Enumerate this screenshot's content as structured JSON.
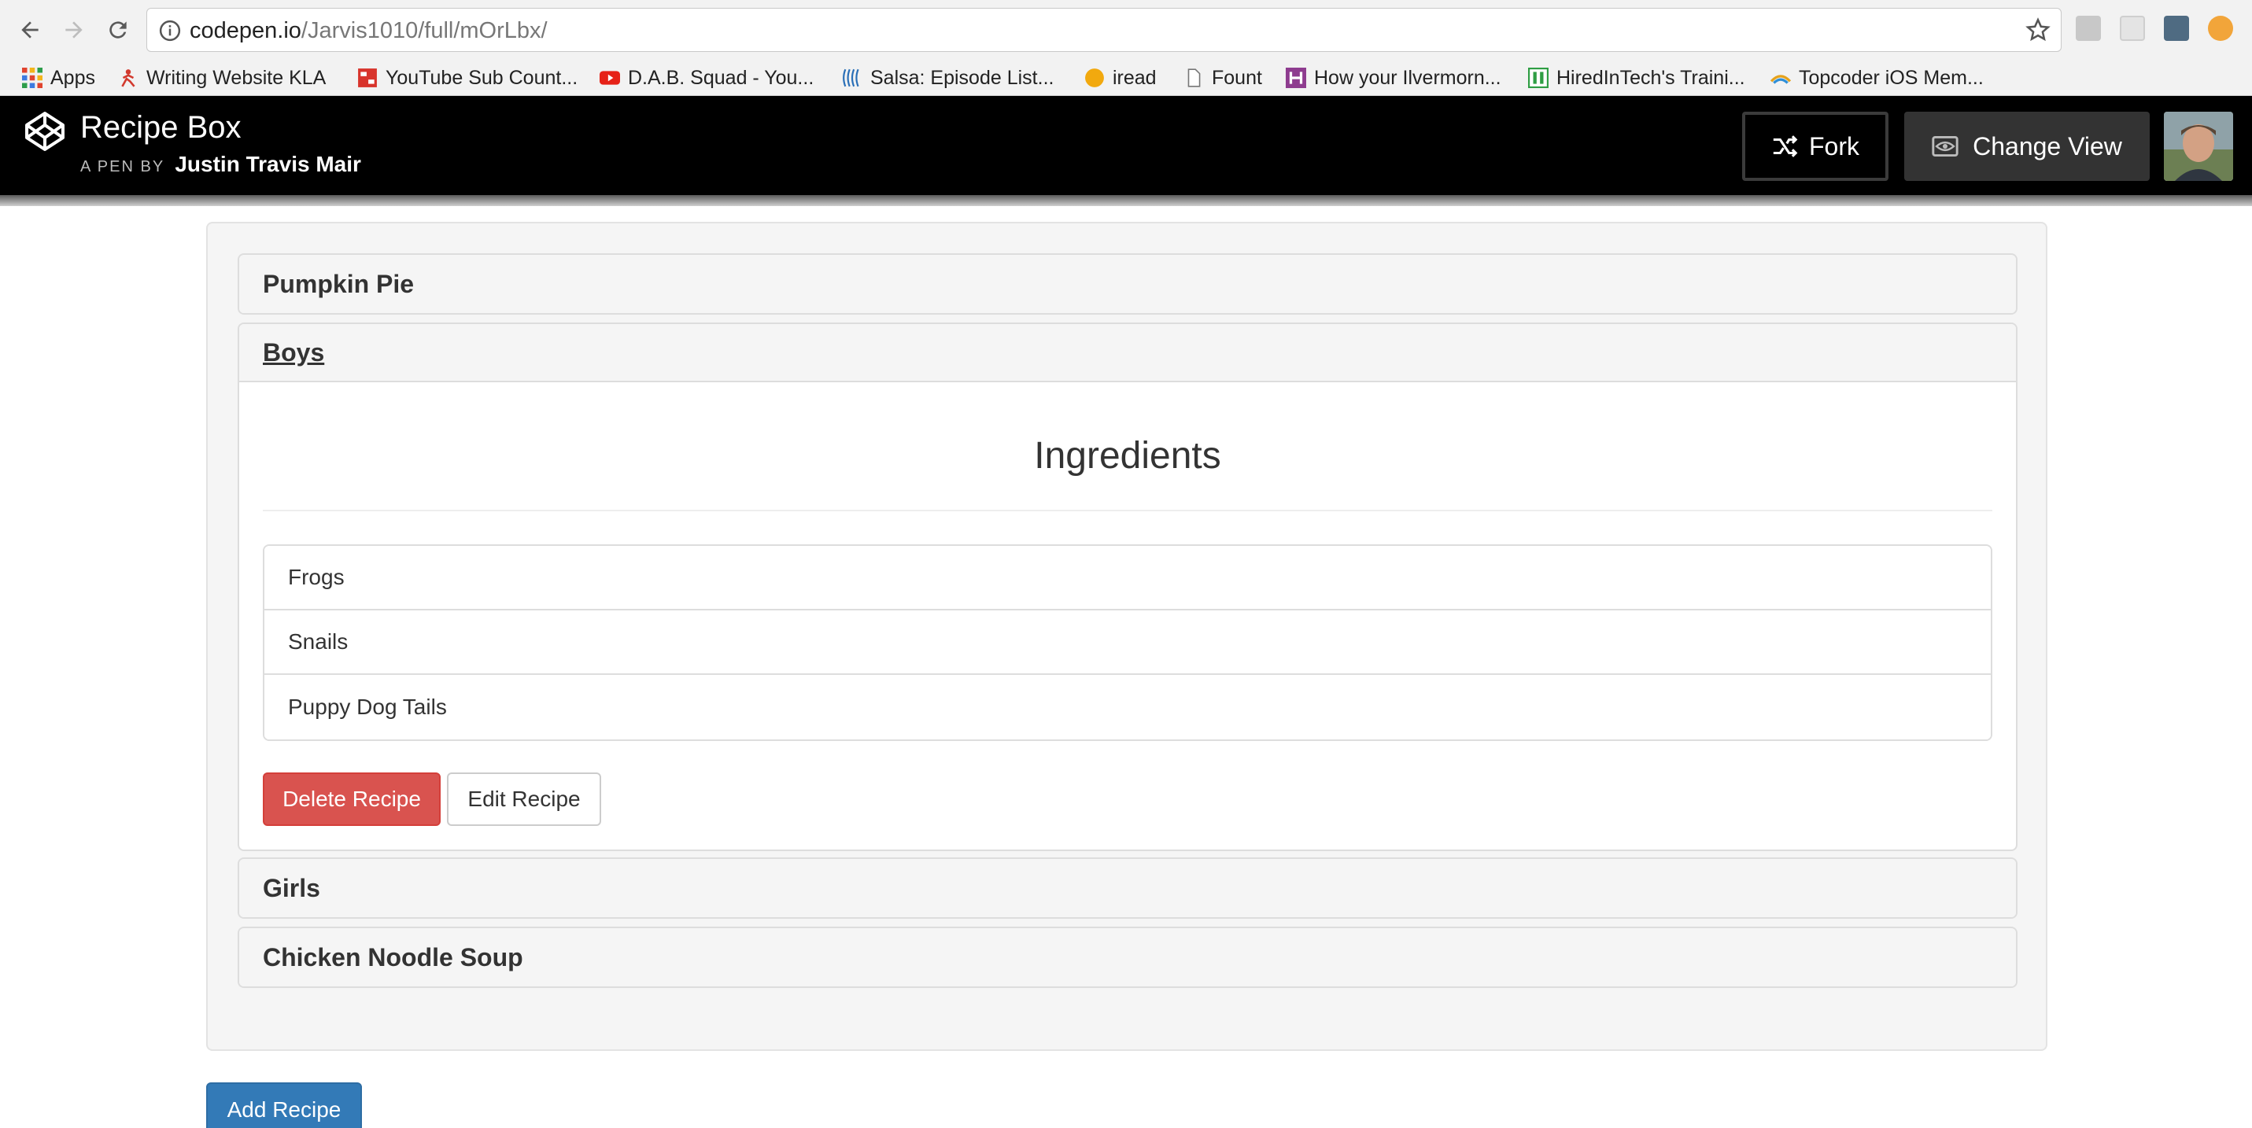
{
  "browser": {
    "url_host": "codepen.io",
    "url_path": "/Jarvis1010/full/mOrLbx/",
    "bookmarks": [
      {
        "label": "Apps",
        "icon": "apps-grid-icon"
      },
      {
        "label": "Writing Website KLA",
        "icon": "figure-icon"
      },
      {
        "label": "YouTube Sub Count...",
        "icon": "yt-sub-icon"
      },
      {
        "label": "D.A.B. Squad - You...",
        "icon": "youtube-icon"
      },
      {
        "label": "Salsa: Episode List...",
        "icon": "salsa-icon"
      },
      {
        "label": "iread",
        "icon": "circle-icon"
      },
      {
        "label": "Fount",
        "icon": "document-icon"
      },
      {
        "label": "How your Ilvermorn...",
        "icon": "h-icon"
      },
      {
        "label": "HiredInTech's Traini...",
        "icon": "hiredintech-icon"
      },
      {
        "label": "Topcoder iOS Mem...",
        "icon": "topcoder-icon"
      }
    ]
  },
  "codepen": {
    "title": "Recipe Box",
    "byline_prefix": "A PEN BY",
    "author": "Justin Travis Mair",
    "fork_label": "Fork",
    "change_view_label": "Change View"
  },
  "recipes": [
    {
      "name": "Pumpkin Pie"
    },
    {
      "name": "Boys"
    },
    {
      "name": "Girls"
    },
    {
      "name": "Chicken Noodle Soup"
    }
  ],
  "expanded": {
    "ingredients_title": "Ingredients",
    "ingredients": [
      "Frogs",
      "Snails",
      "Puppy Dog Tails"
    ],
    "delete_label": "Delete Recipe",
    "edit_label": "Edit Recipe"
  },
  "add_recipe_label": "Add Recipe",
  "colors": {
    "danger": "#d9534f",
    "primary": "#337ab7",
    "header_bg": "#000000"
  }
}
